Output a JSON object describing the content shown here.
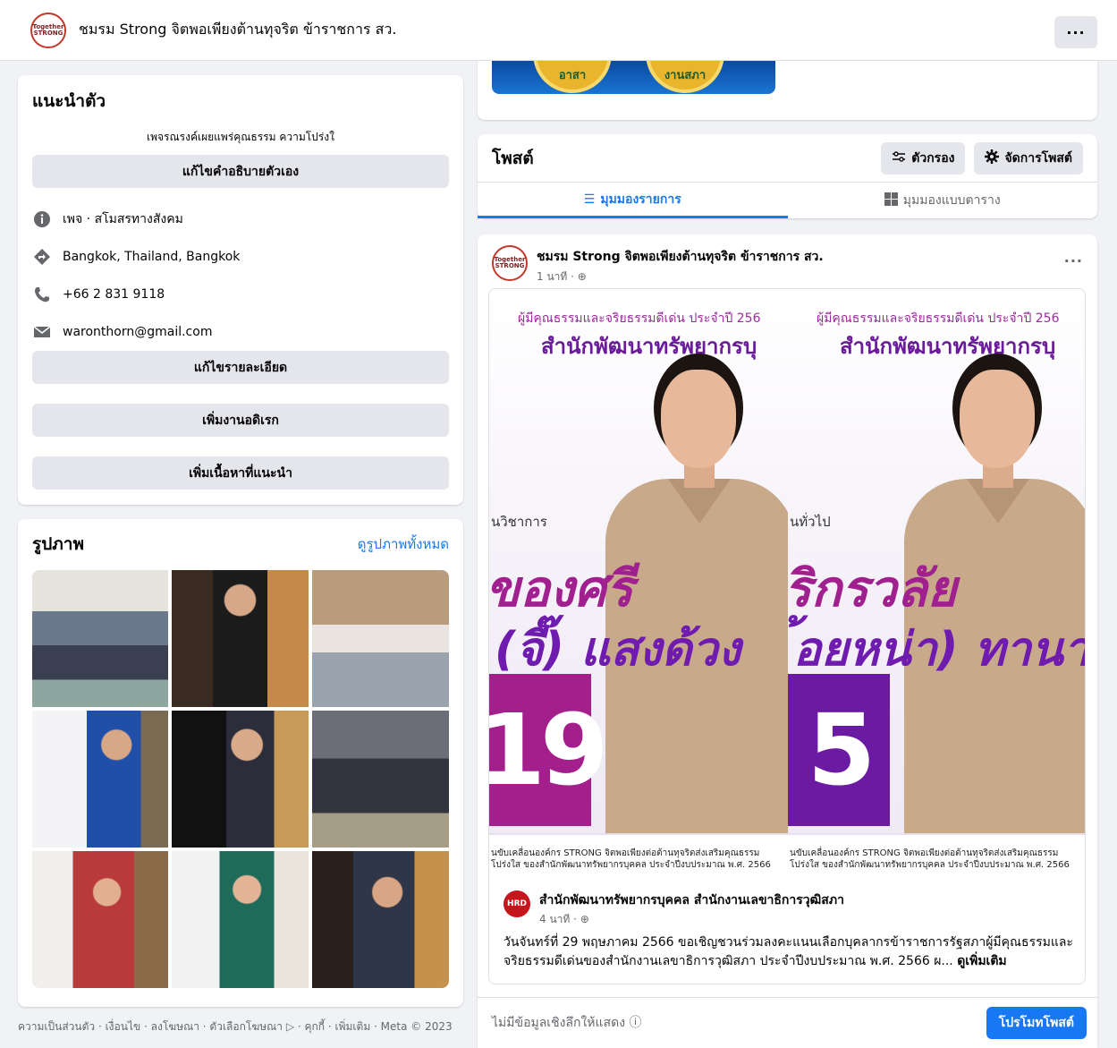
{
  "header": {
    "page_name": "ชมรม Strong จิตพอเพียงต้านทุจริต ข้าราชการ สว.",
    "avatar_text": "Together STRONG",
    "more_label": "···"
  },
  "intro": {
    "title": "แนะนำตัว",
    "bio": "เพจรณรงค์เผยแพร่คุณธรรม ความโปร่งใ",
    "edit_bio_label": "แก้ไขคำอธิบายตัวเอง",
    "items": [
      {
        "icon": "info-icon",
        "text": "เพจ · สโมสรทางสังคม"
      },
      {
        "icon": "location-icon",
        "text": "Bangkok, Thailand, Bangkok"
      },
      {
        "icon": "phone-icon",
        "text": "+66 2 831 9118"
      },
      {
        "icon": "email-icon",
        "text": "waronthorn@gmail.com"
      }
    ],
    "edit_details_label": "แก้ไขรายละเอียด",
    "add_hobbies_label": "เพิ่มงานอดิเรก",
    "add_featured_label": "เพิ่มเนื้อหาที่แนะนำ"
  },
  "photos": {
    "title": "รูปภาพ",
    "see_all": "ดูรูปภาพทั้งหมด"
  },
  "footer": {
    "text": "ความเป็นส่วนตัว · เงื่อนไข · ลงโฆษณา · ตัวเลือกโฆษณา ▷ · คุกกี้ · เพิ่มเติม · Meta © 2023"
  },
  "top_banner": {
    "coin_left": "อาสา",
    "coin_right": "งานสภา"
  },
  "posts_section": {
    "title": "โพสต์",
    "filter_label": "ตัวกรอง",
    "manage_label": "จัดการโพสต์",
    "tab_list": "มุมมองรายการ",
    "tab_grid": "มุมมองแบบตาราง"
  },
  "post": {
    "author": "ชมรม Strong จิตพอเพียงต้านทุจริต ข้าราชการ สว.",
    "time": "1 นาที · ",
    "more_label": "···",
    "posters": [
      {
        "line1": "ผู้มีคุณธรรมและจริยธรรมดีเด่น ประจำปี 256",
        "line2": "สำนักพัฒนาทรัพยากรบุ",
        "subtitle": "นวิชาการ",
        "name1": "ของศรี",
        "name2": "(จี๊) แสงด้วง",
        "number": "19",
        "footer1": "นขับเคลื่อนองค์กร STRONG จิตพอเพียงต่อต้านทุจริตส่งเสริมคุณธรรม",
        "footer2": "โปร่งใส ของสำนักพัฒนาทรัพยากรบุคคล ประจำปีงบประมาณ พ.ศ. 2566"
      },
      {
        "line1": "ผู้มีคุณธรรมและจริยธรรมดีเด่น ประจำปี 256",
        "line2": "สำนักพัฒนาทรัพยากรบุ",
        "subtitle": "นทั่วไป",
        "name1": "ริกรวลัย",
        "name2": "้อยหน่า) ทานาริ",
        "number": "5",
        "footer1": "นขับเคลื่อนองค์กร STRONG จิตพอเพียงต่อต้านทุจริตส่งเสริมคุณธรรม",
        "footer2": "โปร่งใส ของสำนักพัฒนาทรัพยากรบุคคล ประจำปีงบประมาณ พ.ศ. 2566"
      }
    ],
    "shared": {
      "badge": "HRD",
      "author": "สำนักพัฒนาทรัพยากรบุคคล สำนักงานเลขาธิการวุฒิสภา",
      "time": "4 นาที · ",
      "text": "วันจันทร์ที่ 29 พฤษภาคม 2566 ขอเชิญชวนร่วมลงคะแนนเลือกบุคลากรข้าราชการรัฐสภาผู้มีคุณธรรมและจริยธรรมดีเด่นของสำนักงานเลขาธิการวุฒิสภา ประจำปีงบประมาณ พ.ศ. 2566 ผ...",
      "see_more": "ดูเพิ่มเติม"
    },
    "insights_note": "ไม่มีข้อมูลเชิงลึกให้แสดง",
    "promote_label": "โปรโมทโพสต์"
  }
}
